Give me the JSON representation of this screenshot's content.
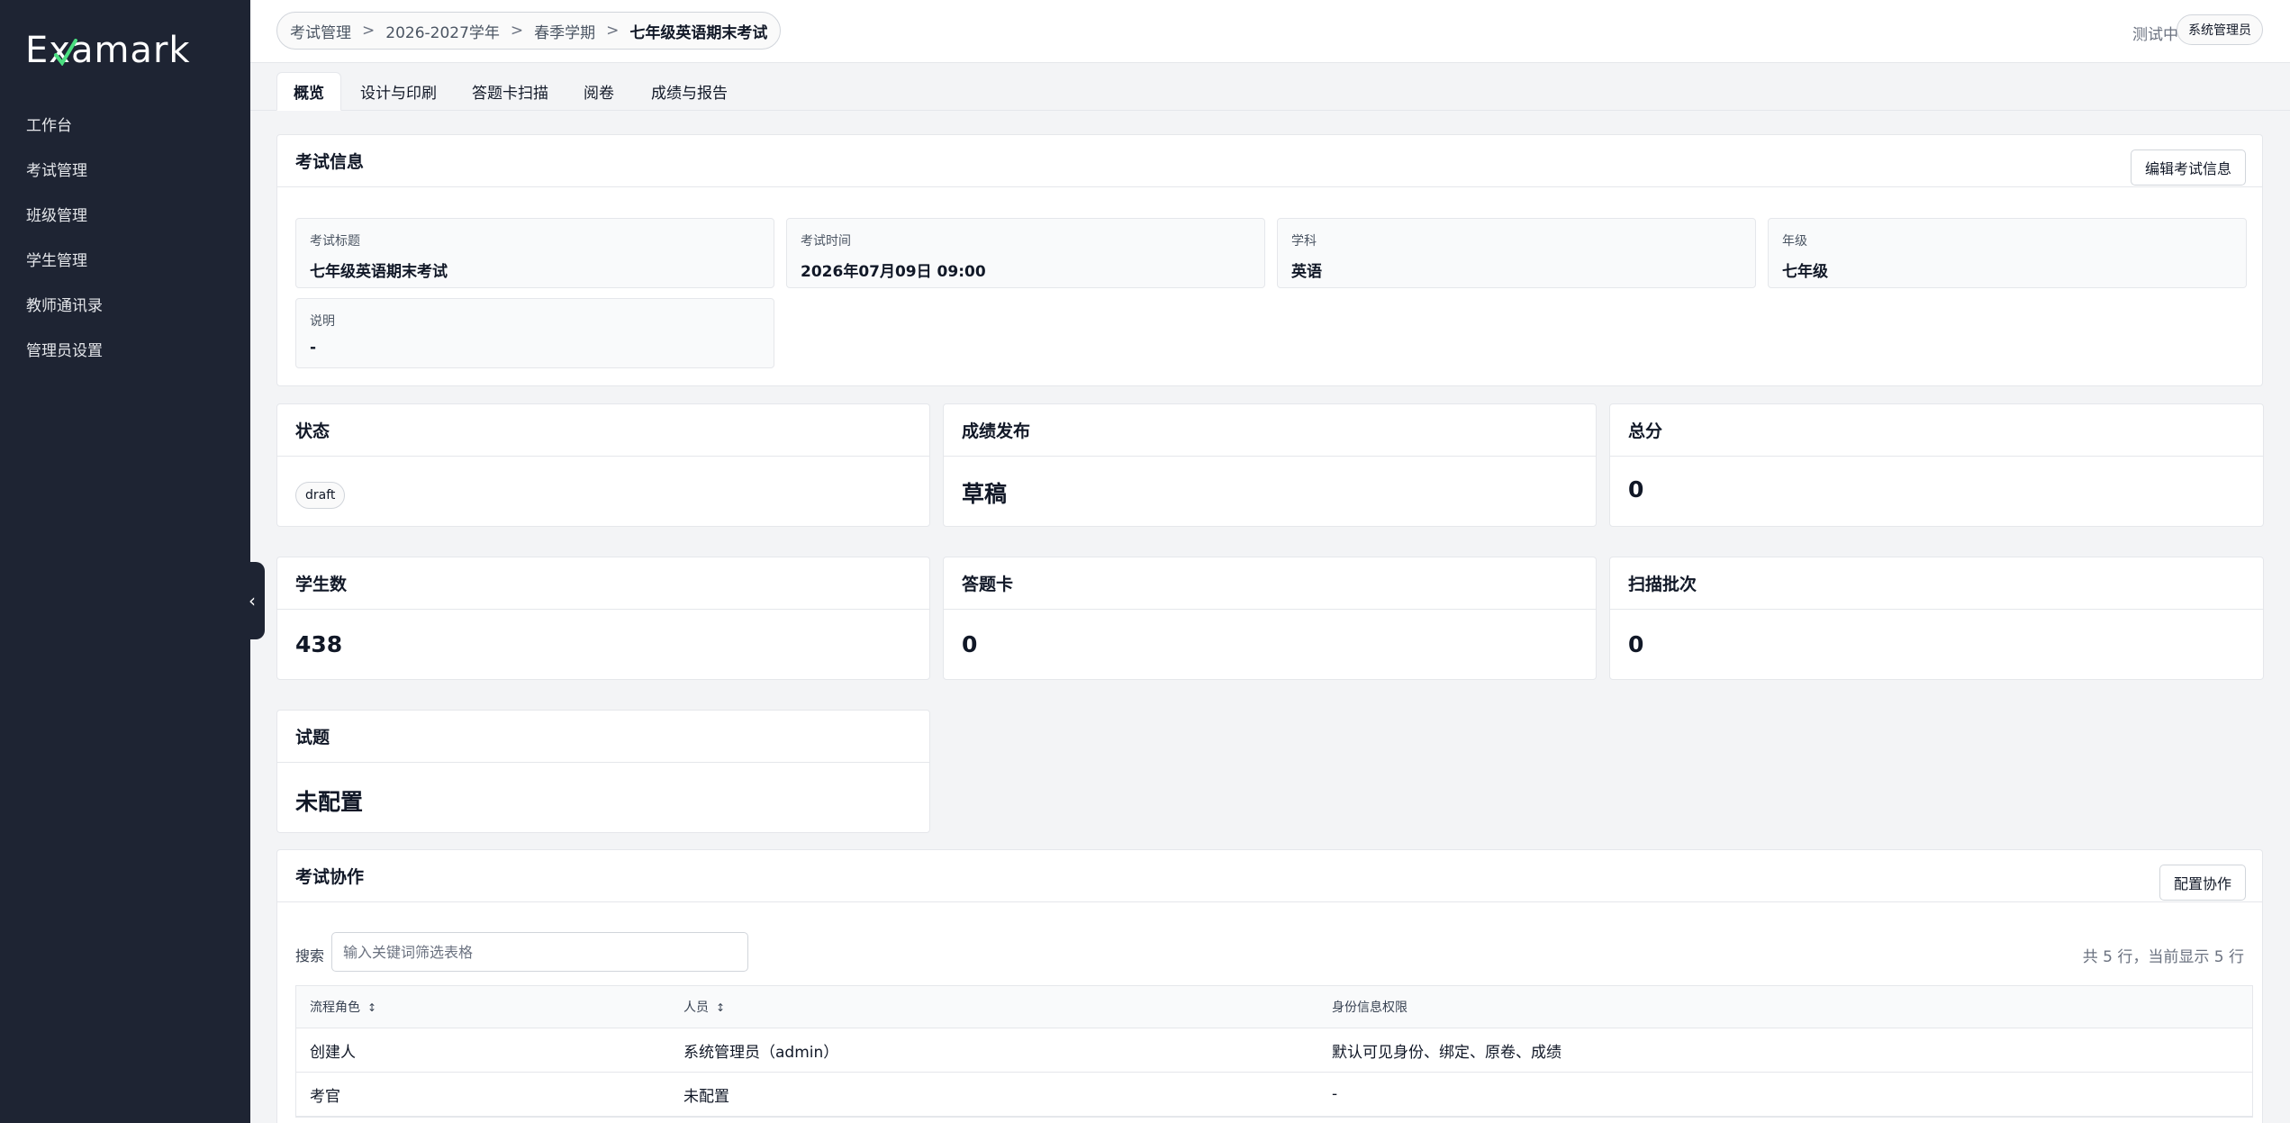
{
  "sidebar": {
    "logo_text": "Examark",
    "logo_lead": "E",
    "logo_mark": "x",
    "logo_rest": "amark",
    "items": [
      {
        "label": "工作台"
      },
      {
        "label": "考试管理"
      },
      {
        "label": "班级管理"
      },
      {
        "label": "学生管理"
      },
      {
        "label": "教师通讯录"
      },
      {
        "label": "管理员设置"
      }
    ],
    "collapse_icon": "chevron-left-icon",
    "collapse_glyph": "‹"
  },
  "header": {
    "breadcrumb": [
      "考试管理",
      "2026-2027学年",
      "春季学期",
      "七年级英语期末考试"
    ],
    "separator": ">",
    "school": "测试中学",
    "role": "系统管理员"
  },
  "tabs": [
    {
      "label": "概览",
      "active": true
    },
    {
      "label": "设计与印刷",
      "active": false
    },
    {
      "label": "答题卡扫描",
      "active": false
    },
    {
      "label": "阅卷",
      "active": false
    },
    {
      "label": "成绩与报告",
      "active": false
    }
  ],
  "exam_info": {
    "title": "考试信息",
    "edit_button": "编辑考试信息",
    "fields": [
      {
        "label": "考试标题",
        "value": "七年级英语期末考试"
      },
      {
        "label": "考试时间",
        "value": "2026年07月09日 09:00"
      },
      {
        "label": "学科",
        "value": "英语"
      },
      {
        "label": "年级",
        "value": "七年级"
      },
      {
        "label": "说明",
        "value": "-"
      }
    ]
  },
  "stats": {
    "status": {
      "title": "状态",
      "value": "draft"
    },
    "publish": {
      "title": "成绩发布",
      "value": "草稿"
    },
    "total_score": {
      "title": "总分",
      "value": "0"
    },
    "students": {
      "title": "学生数",
      "value": "438"
    },
    "answer_cards": {
      "title": "答题卡",
      "value": "0"
    },
    "scan_batches": {
      "title": "扫描批次",
      "value": "0"
    },
    "questions": {
      "title": "试题",
      "value": "未配置"
    }
  },
  "collaboration": {
    "title": "考试协作",
    "config_button": "配置协作",
    "search_label": "搜索",
    "search_placeholder": "输入关键词筛选表格",
    "search_value": "",
    "row_count": "共 5 行，当前显示 5 行",
    "columns": [
      "流程角色",
      "人员",
      "身份信息权限"
    ],
    "sort_glyph": "↕",
    "rows": [
      {
        "role": "创建人",
        "person": "系统管理员（admin）",
        "permission": "默认可见身份、绑定、原卷、成绩"
      },
      {
        "role": "考官",
        "person": "未配置",
        "permission": "-"
      }
    ]
  },
  "colors": {
    "sidebar_bg": "#1e2433",
    "page_bg": "#f3f4f6",
    "logo_check": "#4ade80"
  }
}
